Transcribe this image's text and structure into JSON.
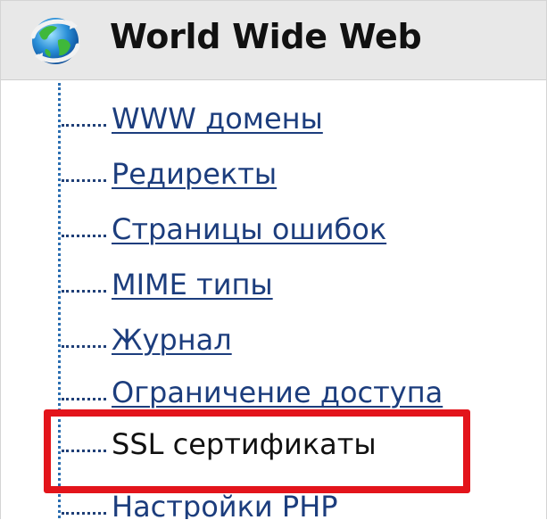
{
  "header": {
    "title": "World Wide Web",
    "icon": "globe-icon"
  },
  "menu": {
    "items": [
      {
        "label": "WWW домены",
        "selected": false
      },
      {
        "label": "Редиректы",
        "selected": false
      },
      {
        "label": "Страницы ошибок",
        "selected": false
      },
      {
        "label": "MIME типы",
        "selected": false
      },
      {
        "label": "Журнал",
        "selected": false
      },
      {
        "label": "Ограничение доступа",
        "selected": false
      },
      {
        "label": "SSL сертификаты",
        "selected": true
      },
      {
        "label": "Настройки PHP",
        "selected": false
      }
    ]
  },
  "colors": {
    "link": "#1c3d7d",
    "highlight": "#e3141b",
    "header_bg": "#e8e8e8"
  }
}
